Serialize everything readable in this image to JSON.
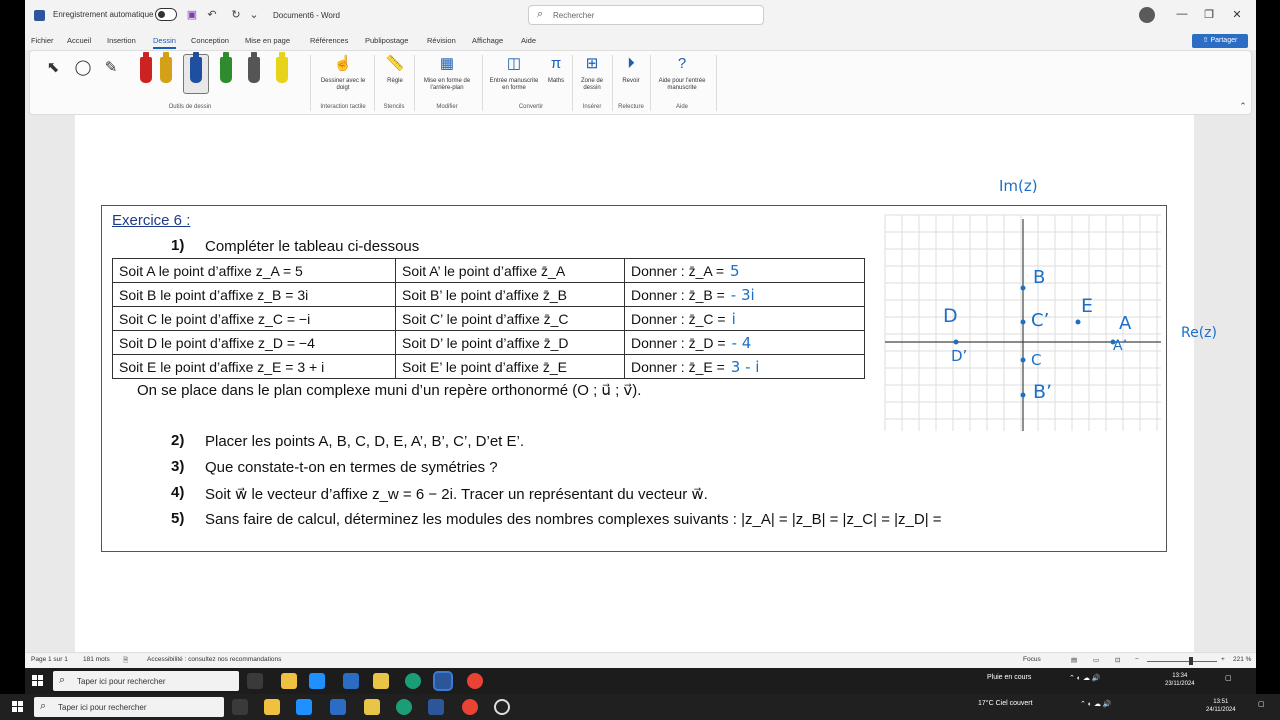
{
  "titlebar": {
    "autosave_label": "Enregistrement automatique",
    "doc_title": "Document6 - Word",
    "search_placeholder": "Rechercher"
  },
  "menu": {
    "tabs": [
      "Fichier",
      "Accueil",
      "Insertion",
      "Dessin",
      "Conception",
      "Mise en page",
      "Références",
      "Publipostage",
      "Révision",
      "Affichage",
      "Aide"
    ],
    "active_tab": "Dessin",
    "share_label": "Partager"
  },
  "ribbon": {
    "groups": {
      "outils": "Outils de dessin",
      "interaction": "Interaction tactile",
      "stencils": "Stencils",
      "modifier": "Modifier",
      "convertir": "Convertir",
      "inserer": "Insérer",
      "relecture": "Relecture",
      "aide": "Aide"
    },
    "buttons": {
      "draw_finger": "Dessiner avec le doigt",
      "ruler": "Règle",
      "format_ink": "Mise en forme de l'arrière-plan",
      "ink_to_shape": "Entrée manuscrite en forme",
      "math": "Maths",
      "draw_zone": "Zone de dessin",
      "replay": "Revoir",
      "help_ink": "Aide pour l'entrée manuscrite"
    },
    "pen_colors": [
      "#cc2222",
      "#d4a017",
      "#1e4fa0",
      "#2e8b2e",
      "#555555",
      "#e6d31a"
    ]
  },
  "document": {
    "exercise_title": "Exercice 6 :",
    "q1_num": "1)",
    "q1_text": "Compléter le tableau ci-dessous",
    "table": [
      [
        "Soit A le point d’affixe z_A = 5",
        "Soit A’ le point d’affixe z̄_A",
        "Donner : z̄_A =",
        "5"
      ],
      [
        "Soit B le point d’affixe z_B = 3i",
        "Soit B’ le point d’affixe z̄_B",
        "Donner : z̄_B =",
        "- 3i"
      ],
      [
        "Soit C le point d’affixe z_C = −i",
        "Soit C’ le point d’affixe z̄_C",
        "Donner : z̄_C =",
        "i"
      ],
      [
        "Soit D le point d’affixe z_D = −4",
        "Soit D’ le point d’affixe z̄_D",
        "Donner : z̄_D =",
        "- 4"
      ],
      [
        "Soit E le point d’affixe z_E = 3 + i",
        "Soit E’ le point d’affixe z̄_E",
        "Donner : z̄_E =",
        "3 - i"
      ]
    ],
    "plan_sentence": "On se place dans le plan complexe muni d’un repère orthonormé (O ; u⃗ ; v⃗).",
    "questions": [
      {
        "num": "2)",
        "text": "Placer les points A, B, C, D, E, A’, B’, C’, D’et E’."
      },
      {
        "num": "3)",
        "text": "Que constate-t-on en termes de symétries ?"
      },
      {
        "num": "4)",
        "text": "Soit w⃗ le vecteur d’affixe z_w = 6 − 2i. Tracer un représentant du vecteur w⃗."
      },
      {
        "num": "5)",
        "text": "Sans faire de calcul, déterminez les modules des nombres complexes suivants : |z_A| =      |z_B| =      |z_C| =      |z_D| ="
      }
    ],
    "graph_labels": {
      "im_axis": "Im(z)",
      "re_axis": "Re(z)",
      "points": [
        "B",
        "C’",
        "E",
        "A",
        "D",
        "A’",
        "D’",
        "C",
        "B’"
      ]
    }
  },
  "statusbar": {
    "page": "Page 1 sur 1",
    "words": "181 mots",
    "accessibility": "Accessibilité : consultez nos recommandations",
    "focus": "Focus",
    "zoom": "221 %"
  },
  "taskbar": {
    "search_placeholder": "Taper ici pour rechercher",
    "weather_1": "Pluie en cours",
    "weather_2": "17°C  Ciel couvert",
    "time_1": "13:34",
    "date_1": "23/11/2024",
    "time_2": "13:51",
    "date_2": "24/11/2024"
  }
}
